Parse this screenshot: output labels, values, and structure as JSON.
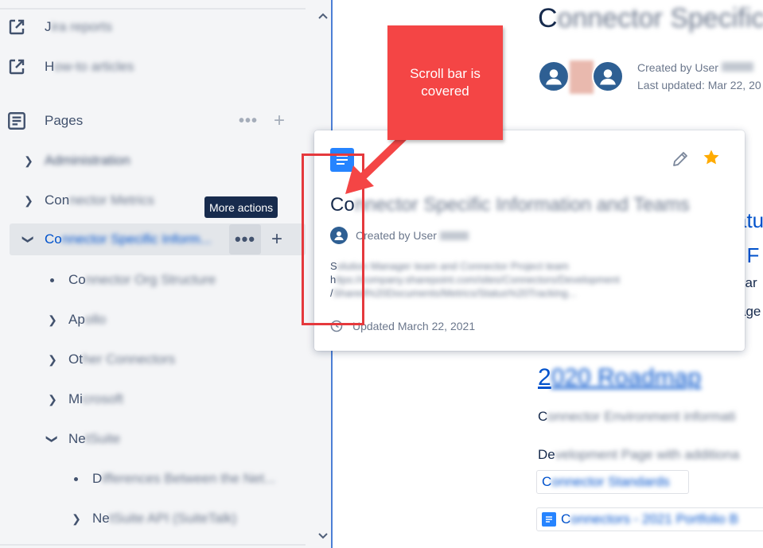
{
  "sidebar": {
    "items": [
      {
        "label": "Jira reports",
        "prefix": "J",
        "icon": "external-link-icon",
        "blurred": true
      },
      {
        "label": "How-to articles",
        "prefix": "H",
        "icon": "external-link-icon",
        "blurred": true
      }
    ],
    "pages_section": {
      "label": "Pages",
      "icon": "pages-icon"
    },
    "tree": [
      {
        "label": "Administration",
        "prefix": "",
        "rest": "Administration",
        "level": 0,
        "expander": "chevron-right"
      },
      {
        "label": "Connector Metrics",
        "prefix": "Con",
        "rest": "nector Metrics",
        "level": 0,
        "expander": "chevron-right"
      },
      {
        "label": "Connector Specific Inform...",
        "prefix": "Co",
        "rest": "nnector Specific Inform...",
        "level": 0,
        "expander": "chevron-down",
        "selected": true
      },
      {
        "label": "Connector Org Structure",
        "prefix": "Co",
        "rest": "nnector Org Structure",
        "level": 1,
        "expander": "bullet"
      },
      {
        "label": "Apollo",
        "prefix": "Ap",
        "rest": "ollo",
        "level": 1,
        "expander": "chevron-right"
      },
      {
        "label": "Other Connectors",
        "prefix": "Ot",
        "rest": "her Connectors",
        "level": 1,
        "expander": "chevron-right"
      },
      {
        "label": "Microsoft",
        "prefix": "Mi",
        "rest": "crosoft",
        "level": 1,
        "expander": "chevron-right"
      },
      {
        "label": "NetSuite",
        "prefix": "Ne",
        "rest": "tSuite",
        "level": 1,
        "expander": "chevron-down"
      },
      {
        "label": "Differences Between the Net...",
        "prefix": "D",
        "rest": "ifferences Between the Net...",
        "level": 2,
        "expander": "bullet"
      },
      {
        "label": "NetSuite API (SuiteTalk)",
        "prefix": "Ne",
        "rest": "tSuite API (SuiteTalk)",
        "level": 2,
        "expander": "chevron-right"
      }
    ],
    "tooltip": "More actions"
  },
  "main": {
    "title_prefix": "C",
    "title_rest": "onnector Specific",
    "created_by": "Created by User",
    "last_updated": "Last updated: Mar 22, 20",
    "frag1": "atu",
    "frag2": "t F",
    "frag3": "car",
    "frag4": "age",
    "link_big_prefix": "2",
    "link_big_rest": "020 Roadmap",
    "line1_prefix": "C",
    "line1_rest": "onnector Environment informati",
    "line2_prefix": "De",
    "line2_rest": "velopment Page with additiona",
    "chip1_prefix": "C",
    "chip1_rest": "onnector Standards",
    "chip2_prefix": "C",
    "chip2_rest": "onnectors - 2021 Portfolio B"
  },
  "hovercard": {
    "title_prefix": "Co",
    "title_rest": "nnector Specific Information and Teams",
    "author_prefix": "Created by User",
    "excerpt_line1_prefix": "S",
    "excerpt_line1_rest": "olution Manager team and Connector Project team",
    "excerpt_line2_prefix": "h",
    "excerpt_line2_rest": "ttps://company.sharepoint.com/sites/Connectors/Development",
    "excerpt_line3_prefix": "/",
    "excerpt_line3_rest": "Shared%20Documents/Metrics/Status%20Tracking...",
    "updated": "Updated March 22, 2021"
  },
  "annotation": {
    "callout_text": "Scroll bar is covered",
    "color": "#f44545"
  },
  "colors": {
    "accent": "#0052cc",
    "sidebar_bg": "#f4f5f7",
    "doc_icon": "#2684ff",
    "star": "#ffab00"
  }
}
